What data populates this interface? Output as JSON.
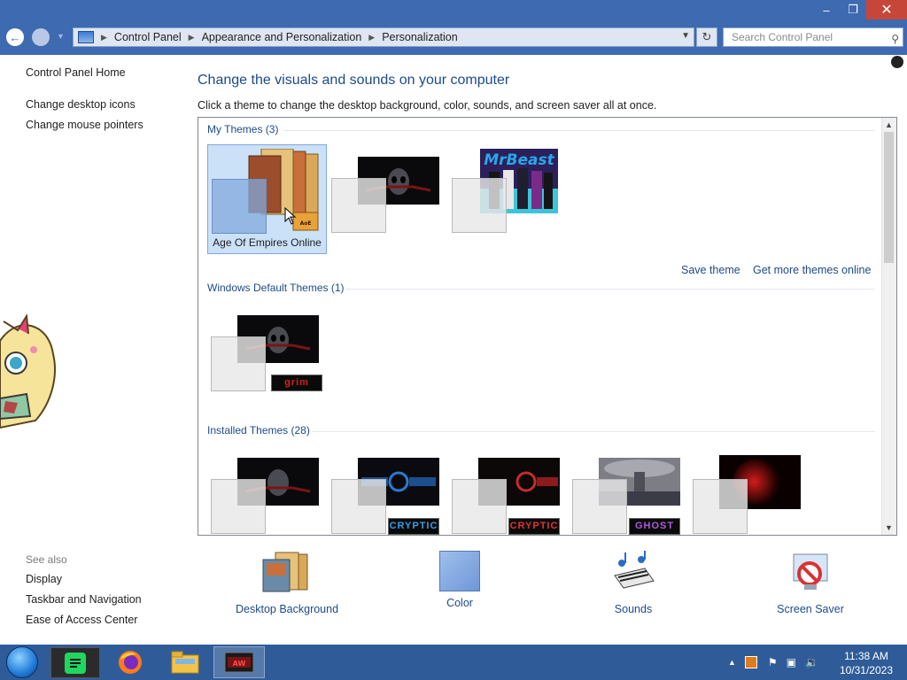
{
  "window": {
    "minimize_glyph": "–",
    "restore_glyph": "❐",
    "close_glyph": "✕"
  },
  "address": {
    "crumbs": [
      "Control Panel",
      "Appearance and Personalization",
      "Personalization"
    ],
    "search_placeholder": "Search Control Panel"
  },
  "sidebar": {
    "home": "Control Panel Home",
    "links": [
      "Change desktop icons",
      "Change mouse pointers"
    ],
    "see_also_title": "See also",
    "see_also": [
      "Display",
      "Taskbar and Navigation",
      "Ease of Access Center"
    ]
  },
  "main": {
    "heading": "Change the visuals and sounds on your computer",
    "description": "Click a theme to change the desktop background, color, sounds, and screen saver all at once.",
    "groups": {
      "my_themes": "My Themes (3)",
      "windows_default": "Windows Default Themes (1)",
      "installed": "Installed Themes (28)"
    },
    "selected_theme_name": "Age Of Empires Online",
    "save_theme": "Save theme",
    "get_more": "Get more themes online",
    "badges": {
      "grim": "grim",
      "cryptic_blue": "CRYPTIC",
      "cryptic_red": "CRYPTIC",
      "ghost": "GHOST"
    }
  },
  "bottom": {
    "desktop_background": "Desktop Background",
    "color": "Color",
    "sounds": "Sounds",
    "screen_saver": "Screen Saver"
  },
  "taskbar": {
    "time": "11:38 AM",
    "date": "10/31/2023"
  },
  "colors": {
    "titlebar": "#3d6ab0",
    "link": "#1d4a8a",
    "selection": "#cbe1f8",
    "taskbar": "#2f5c99",
    "close": "#c7463a"
  }
}
